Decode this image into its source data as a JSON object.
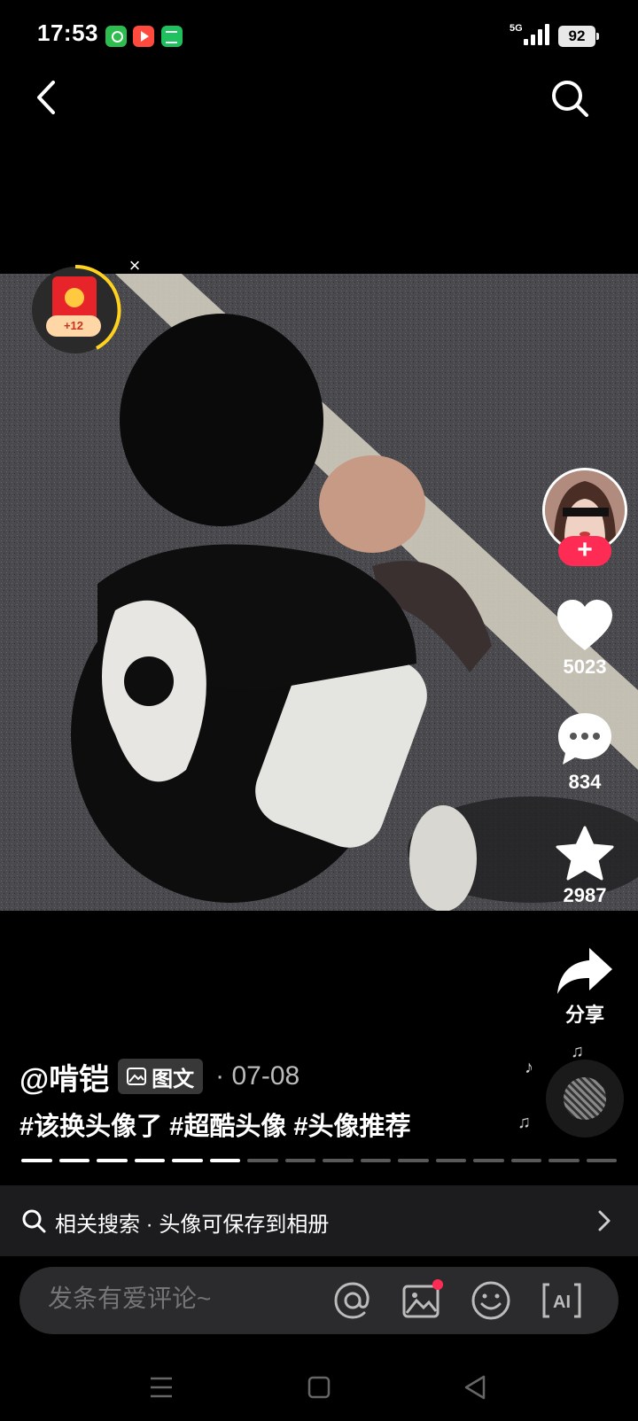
{
  "status_bar": {
    "time": "17:53",
    "network": "5G",
    "battery": "92"
  },
  "header": {
    "back_icon": "chevron-left-icon",
    "search_icon": "search-icon"
  },
  "red_packet": {
    "reward": "+12",
    "close": "×"
  },
  "actions": {
    "likes": "5023",
    "comments": "834",
    "favorites": "2987",
    "share": "分享"
  },
  "post": {
    "author": "@啃铠",
    "type_label": "图文",
    "date": "· 07-08",
    "hashtags": "#该换头像了 #超酷头像 #头像推荐",
    "images_total": 16,
    "current_image": 6
  },
  "related_search": {
    "text": "相关搜索 · 头像可保存到相册"
  },
  "comment_bar": {
    "placeholder": "发条有爱评论~"
  },
  "colors": {
    "accent": "#fe2c55",
    "background": "#000000",
    "bar": "#2b2b2d"
  }
}
